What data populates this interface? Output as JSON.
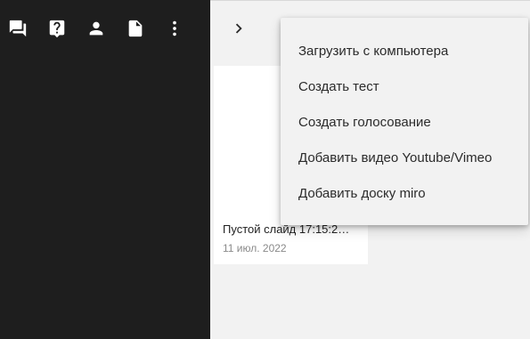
{
  "toolbar": {
    "items": [
      {
        "icon": "chat-icon"
      },
      {
        "icon": "question-icon"
      },
      {
        "icon": "person-icon"
      },
      {
        "icon": "document-icon"
      },
      {
        "icon": "more-vert-icon"
      }
    ],
    "icon_color": "#ffffff"
  },
  "panel": {
    "expand_icon": "chevron-right-icon"
  },
  "slides": [
    {
      "title": "Пустой слайд 17:15:2…",
      "date": "11 июл. 2022"
    }
  ],
  "menu": {
    "items": [
      {
        "label": "Загрузить с компьютера"
      },
      {
        "label": "Создать тест"
      },
      {
        "label": "Создать голосование"
      },
      {
        "label": "Добавить видео Youtube/Vimeo"
      },
      {
        "label": "Добавить доску miro"
      }
    ]
  },
  "colors": {
    "sidebar_bg": "#1e1e1e",
    "content_bg": "#f2f2f2",
    "card_bg": "#ffffff",
    "menu_bg": "#f2f2f2"
  }
}
